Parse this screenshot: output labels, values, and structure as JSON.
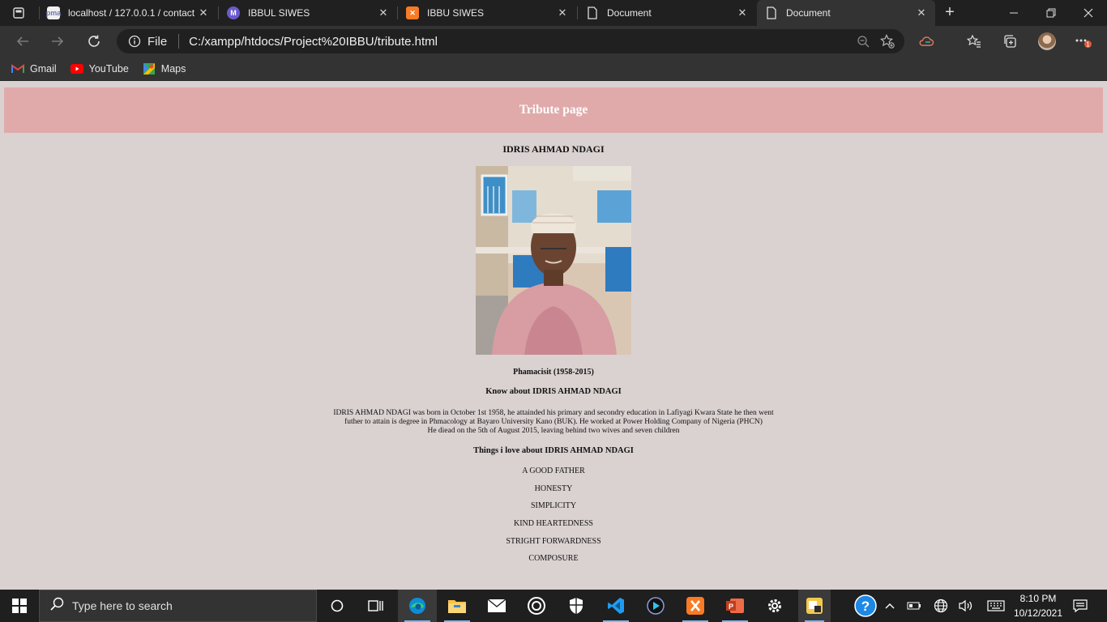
{
  "browser": {
    "tabs": [
      {
        "title": "localhost / 127.0.0.1 / contact",
        "icon": "phpmyadmin-icon",
        "active": false
      },
      {
        "title": "IBBUL SIWES",
        "icon": "m-logo-icon",
        "active": false
      },
      {
        "title": "IBBU SIWES",
        "icon": "xampp-icon",
        "active": false
      },
      {
        "title": "Document",
        "icon": "document-icon",
        "active": false
      },
      {
        "title": "Document",
        "icon": "document-icon",
        "active": true
      }
    ],
    "address": {
      "scheme_label": "File",
      "url": "C:/xampp/htdocs/Project%20IBBU/tribute.html"
    },
    "bookmarks": [
      {
        "label": "Gmail",
        "icon": "gmail-icon"
      },
      {
        "label": "YouTube",
        "icon": "youtube-icon"
      },
      {
        "label": "Maps",
        "icon": "maps-icon"
      }
    ],
    "notification_badge": "1"
  },
  "page": {
    "banner_title": "Tribute page",
    "person_name": "IDRIS AHMAD NDAGI",
    "photo_desc": "portrait-photo",
    "role": "Phamacisit (1958-2015)",
    "know_heading": "Know about IDRIS AHMAD NDAGI",
    "bio_lines": [
      "IDRIS AHMAD NDAGI was born in October 1st 1958, he attainded his primary and secondry education in Lafiyagi Kwara State he then went",
      "futher to attain is degree in Phmacology at Bayaro University Kano (BUK). He worked at Power Holding Company of Nigeria (PHCN)",
      "He diead on the 5th of August 2015, leaving behind two wives and seven children"
    ],
    "loves_heading": "Things i love about IDRIS AHMAD NDAGI",
    "loves": [
      "A GOOD FATHER",
      "HONESTY",
      "SIMPLICITY",
      "KIND HEARTEDNESS",
      "STRIGHT FORWARDNESS",
      "COMPOSURE"
    ]
  },
  "taskbar": {
    "search_placeholder": "Type here to search",
    "time": "8:10 PM",
    "date": "10/12/2021"
  },
  "colors": {
    "page_bg": "#dad1d1",
    "banner_bg": "#e0aaaa",
    "banner_text": "#ffffff",
    "browser_chrome": "#333333"
  }
}
